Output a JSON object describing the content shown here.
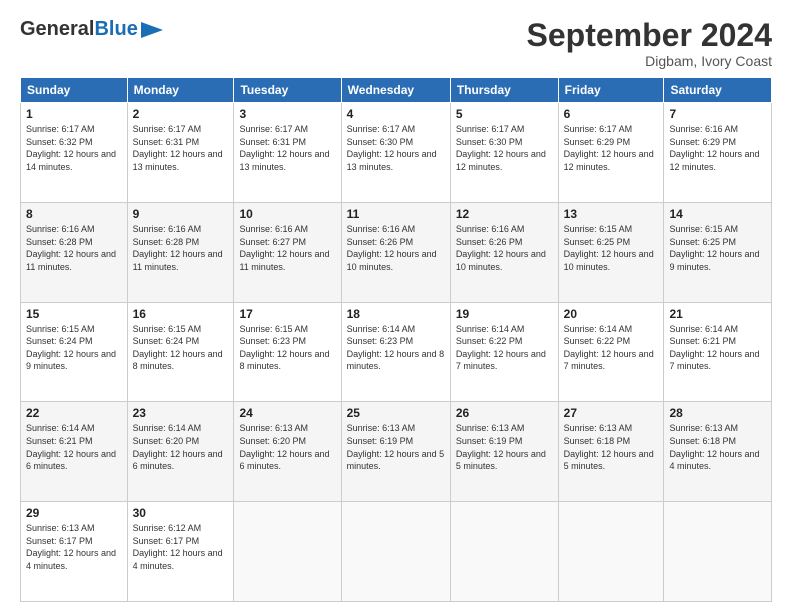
{
  "header": {
    "logo_general": "General",
    "logo_blue": "Blue",
    "month_title": "September 2024",
    "location": "Digbam, Ivory Coast"
  },
  "days_of_week": [
    "Sunday",
    "Monday",
    "Tuesday",
    "Wednesday",
    "Thursday",
    "Friday",
    "Saturday"
  ],
  "weeks": [
    [
      {
        "day": "1",
        "sunrise": "6:17 AM",
        "sunset": "6:32 PM",
        "daylight": "12 hours and 14 minutes."
      },
      {
        "day": "2",
        "sunrise": "6:17 AM",
        "sunset": "6:31 PM",
        "daylight": "12 hours and 13 minutes."
      },
      {
        "day": "3",
        "sunrise": "6:17 AM",
        "sunset": "6:31 PM",
        "daylight": "12 hours and 13 minutes."
      },
      {
        "day": "4",
        "sunrise": "6:17 AM",
        "sunset": "6:30 PM",
        "daylight": "12 hours and 13 minutes."
      },
      {
        "day": "5",
        "sunrise": "6:17 AM",
        "sunset": "6:30 PM",
        "daylight": "12 hours and 12 minutes."
      },
      {
        "day": "6",
        "sunrise": "6:17 AM",
        "sunset": "6:29 PM",
        "daylight": "12 hours and 12 minutes."
      },
      {
        "day": "7",
        "sunrise": "6:16 AM",
        "sunset": "6:29 PM",
        "daylight": "12 hours and 12 minutes."
      }
    ],
    [
      {
        "day": "8",
        "sunrise": "6:16 AM",
        "sunset": "6:28 PM",
        "daylight": "12 hours and 11 minutes."
      },
      {
        "day": "9",
        "sunrise": "6:16 AM",
        "sunset": "6:28 PM",
        "daylight": "12 hours and 11 minutes."
      },
      {
        "day": "10",
        "sunrise": "6:16 AM",
        "sunset": "6:27 PM",
        "daylight": "12 hours and 11 minutes."
      },
      {
        "day": "11",
        "sunrise": "6:16 AM",
        "sunset": "6:26 PM",
        "daylight": "12 hours and 10 minutes."
      },
      {
        "day": "12",
        "sunrise": "6:16 AM",
        "sunset": "6:26 PM",
        "daylight": "12 hours and 10 minutes."
      },
      {
        "day": "13",
        "sunrise": "6:15 AM",
        "sunset": "6:25 PM",
        "daylight": "12 hours and 10 minutes."
      },
      {
        "day": "14",
        "sunrise": "6:15 AM",
        "sunset": "6:25 PM",
        "daylight": "12 hours and 9 minutes."
      }
    ],
    [
      {
        "day": "15",
        "sunrise": "6:15 AM",
        "sunset": "6:24 PM",
        "daylight": "12 hours and 9 minutes."
      },
      {
        "day": "16",
        "sunrise": "6:15 AM",
        "sunset": "6:24 PM",
        "daylight": "12 hours and 8 minutes."
      },
      {
        "day": "17",
        "sunrise": "6:15 AM",
        "sunset": "6:23 PM",
        "daylight": "12 hours and 8 minutes."
      },
      {
        "day": "18",
        "sunrise": "6:14 AM",
        "sunset": "6:23 PM",
        "daylight": "12 hours and 8 minutes."
      },
      {
        "day": "19",
        "sunrise": "6:14 AM",
        "sunset": "6:22 PM",
        "daylight": "12 hours and 7 minutes."
      },
      {
        "day": "20",
        "sunrise": "6:14 AM",
        "sunset": "6:22 PM",
        "daylight": "12 hours and 7 minutes."
      },
      {
        "day": "21",
        "sunrise": "6:14 AM",
        "sunset": "6:21 PM",
        "daylight": "12 hours and 7 minutes."
      }
    ],
    [
      {
        "day": "22",
        "sunrise": "6:14 AM",
        "sunset": "6:21 PM",
        "daylight": "12 hours and 6 minutes."
      },
      {
        "day": "23",
        "sunrise": "6:14 AM",
        "sunset": "6:20 PM",
        "daylight": "12 hours and 6 minutes."
      },
      {
        "day": "24",
        "sunrise": "6:13 AM",
        "sunset": "6:20 PM",
        "daylight": "12 hours and 6 minutes."
      },
      {
        "day": "25",
        "sunrise": "6:13 AM",
        "sunset": "6:19 PM",
        "daylight": "12 hours and 5 minutes."
      },
      {
        "day": "26",
        "sunrise": "6:13 AM",
        "sunset": "6:19 PM",
        "daylight": "12 hours and 5 minutes."
      },
      {
        "day": "27",
        "sunrise": "6:13 AM",
        "sunset": "6:18 PM",
        "daylight": "12 hours and 5 minutes."
      },
      {
        "day": "28",
        "sunrise": "6:13 AM",
        "sunset": "6:18 PM",
        "daylight": "12 hours and 4 minutes."
      }
    ],
    [
      {
        "day": "29",
        "sunrise": "6:13 AM",
        "sunset": "6:17 PM",
        "daylight": "12 hours and 4 minutes."
      },
      {
        "day": "30",
        "sunrise": "6:12 AM",
        "sunset": "6:17 PM",
        "daylight": "12 hours and 4 minutes."
      },
      null,
      null,
      null,
      null,
      null
    ]
  ]
}
